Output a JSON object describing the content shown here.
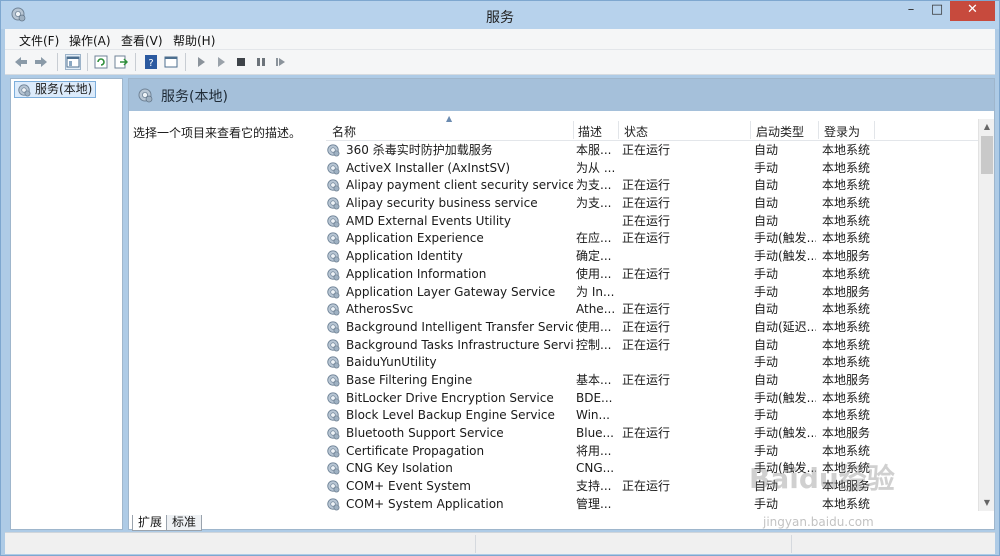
{
  "window": {
    "title": "服务"
  },
  "menu": [
    "文件(F)",
    "操作(A)",
    "查看(V)",
    "帮助(H)"
  ],
  "toolbar": {
    "icons": [
      "back-icon",
      "forward-icon",
      "show-hide-tree-icon",
      "refresh-icon",
      "export-list-icon",
      "help-icon",
      "properties-icon",
      "start-service-icon",
      "start-service-alt-icon",
      "stop-service-icon",
      "pause-service-icon",
      "restart-service-icon"
    ]
  },
  "tree": {
    "root_label": "服务(本地)"
  },
  "main": {
    "header_title": "服务(本地)",
    "description_prompt": "选择一个项目来查看它的描述。"
  },
  "columns": {
    "name": "名称",
    "desc": "描述",
    "status": "状态",
    "startup": "启动类型",
    "logon": "登录为"
  },
  "services": [
    {
      "name": "360 杀毒实时防护加载服务",
      "desc": "本服...",
      "status": "正在运行",
      "startup": "自动",
      "logon": "本地系统"
    },
    {
      "name": "ActiveX Installer (AxInstSV)",
      "desc": "为从 ...",
      "status": "",
      "startup": "手动",
      "logon": "本地系统"
    },
    {
      "name": "Alipay payment client security service",
      "desc": "为支...",
      "status": "正在运行",
      "startup": "自动",
      "logon": "本地系统"
    },
    {
      "name": "Alipay security business service",
      "desc": "为支...",
      "status": "正在运行",
      "startup": "自动",
      "logon": "本地系统"
    },
    {
      "name": "AMD External Events Utility",
      "desc": "",
      "status": "正在运行",
      "startup": "自动",
      "logon": "本地系统"
    },
    {
      "name": "Application Experience",
      "desc": "在应...",
      "status": "正在运行",
      "startup": "手动(触发...",
      "logon": "本地系统"
    },
    {
      "name": "Application Identity",
      "desc": "确定...",
      "status": "",
      "startup": "手动(触发...",
      "logon": "本地服务"
    },
    {
      "name": "Application Information",
      "desc": "使用...",
      "status": "正在运行",
      "startup": "手动",
      "logon": "本地系统"
    },
    {
      "name": "Application Layer Gateway Service",
      "desc": "为 In...",
      "status": "",
      "startup": "手动",
      "logon": "本地服务"
    },
    {
      "name": "AtherosSvc",
      "desc": "Athe...",
      "status": "正在运行",
      "startup": "自动",
      "logon": "本地系统"
    },
    {
      "name": "Background Intelligent Transfer Service",
      "desc": "使用...",
      "status": "正在运行",
      "startup": "自动(延迟...",
      "logon": "本地系统"
    },
    {
      "name": "Background Tasks Infrastructure Service",
      "desc": "控制...",
      "status": "正在运行",
      "startup": "自动",
      "logon": "本地系统"
    },
    {
      "name": "BaiduYunUtility",
      "desc": "",
      "status": "",
      "startup": "手动",
      "logon": "本地系统"
    },
    {
      "name": "Base Filtering Engine",
      "desc": "基本...",
      "status": "正在运行",
      "startup": "自动",
      "logon": "本地服务"
    },
    {
      "name": "BitLocker Drive Encryption Service",
      "desc": "BDE...",
      "status": "",
      "startup": "手动(触发...",
      "logon": "本地系统"
    },
    {
      "name": "Block Level Backup Engine Service",
      "desc": "Win...",
      "status": "",
      "startup": "手动",
      "logon": "本地系统"
    },
    {
      "name": "Bluetooth Support Service",
      "desc": "Blue...",
      "status": "正在运行",
      "startup": "手动(触发...",
      "logon": "本地服务"
    },
    {
      "name": "Certificate Propagation",
      "desc": "将用...",
      "status": "",
      "startup": "手动",
      "logon": "本地系统"
    },
    {
      "name": "CNG Key Isolation",
      "desc": "CNG...",
      "status": "",
      "startup": "手动(触发...",
      "logon": "本地系统"
    },
    {
      "name": "COM+ Event System",
      "desc": "支持...",
      "status": "正在运行",
      "startup": "自动",
      "logon": "本地服务"
    },
    {
      "name": "COM+ System Application",
      "desc": "管理...",
      "status": "",
      "startup": "手动",
      "logon": "本地系统"
    }
  ],
  "bottom_tabs": [
    "扩展",
    "标准"
  ],
  "watermark": {
    "logo": "Baidu经验",
    "url": "jingyan.baidu.com"
  },
  "colors": {
    "titlebar": "#b7d2ec",
    "header": "#a5c0da",
    "close": "#c74a3d",
    "selection": "#dcebfb"
  }
}
